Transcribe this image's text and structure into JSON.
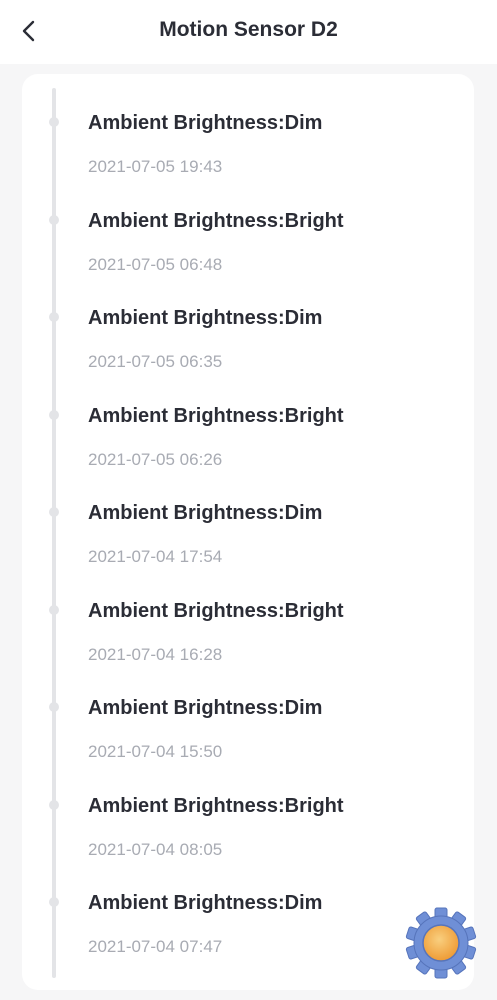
{
  "header": {
    "title": "Motion Sensor D2",
    "back_icon": "chevron-left-icon"
  },
  "events": [
    {
      "title": "Ambient Brightness:Dim",
      "time": "2021-07-05 19:43"
    },
    {
      "title": "Ambient Brightness:Bright",
      "time": "2021-07-05 06:48"
    },
    {
      "title": "Ambient Brightness:Dim",
      "time": "2021-07-05 06:35"
    },
    {
      "title": "Ambient Brightness:Bright",
      "time": "2021-07-05 06:26"
    },
    {
      "title": "Ambient Brightness:Dim",
      "time": "2021-07-04 17:54"
    },
    {
      "title": "Ambient Brightness:Bright",
      "time": "2021-07-04 16:28"
    },
    {
      "title": "Ambient Brightness:Dim",
      "time": "2021-07-04 15:50"
    },
    {
      "title": "Ambient Brightness:Bright",
      "time": "2021-07-04 08:05"
    },
    {
      "title": "Ambient Brightness:Dim",
      "time": "2021-07-04 07:47"
    }
  ],
  "floating_button": {
    "icon": "gear-icon"
  },
  "colors": {
    "title_text": "#2b2d36",
    "secondary_text": "#a8abb3",
    "timeline": "#e3e4e7",
    "page_background": "#f6f6f7",
    "card_background": "#ffffff",
    "gear_blue": "#6f8fd6",
    "gear_orange": "#f2a640"
  }
}
